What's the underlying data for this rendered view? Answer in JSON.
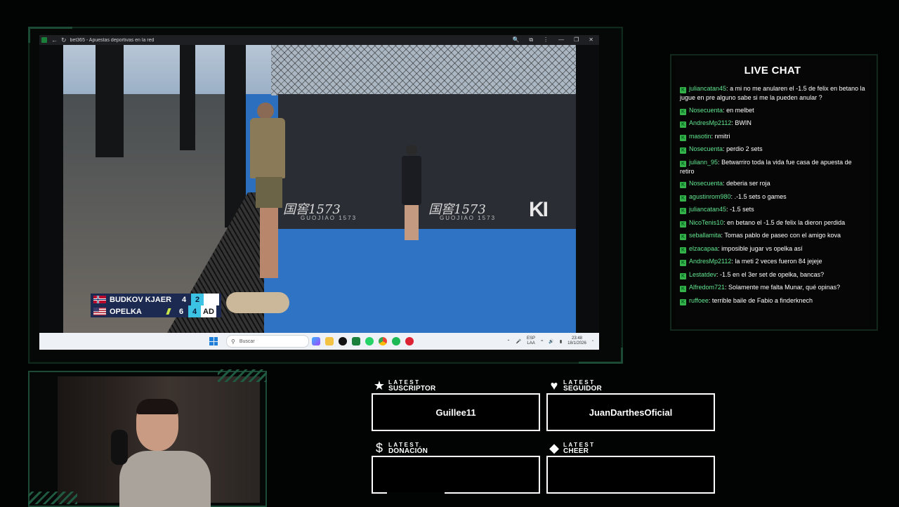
{
  "browser": {
    "title": "bet365 - Apuestas deportivas en la red"
  },
  "video": {
    "sponsor_left": "国窖1573",
    "sponsor_left_sub": "GUOJIAO 1573",
    "sponsor_right": "国窖1573",
    "sponsor_right_sub": "GUOJIAO 1573",
    "sponsor_ki": "KI"
  },
  "scoreboard": {
    "players": [
      {
        "name": "BUDKOV KJAER",
        "games": "4",
        "sets": "2",
        "points": ""
      },
      {
        "name": "OPELKA",
        "games": "6",
        "sets": "4",
        "points": "AD"
      }
    ]
  },
  "taskbar": {
    "search_placeholder": "Buscar",
    "lang_1": "ESP",
    "lang_2": "LAA",
    "time": "23:48",
    "date": "18/1/2026"
  },
  "chat": {
    "title": "LIVE CHAT",
    "messages": [
      {
        "user": "juliancatan45",
        "text": "a mi no me anularen el -1.5 de felix en betano la jugue en pre alguno sabe si me la pueden anular ?"
      },
      {
        "user": "Nosecuenta",
        "text": "en melbet"
      },
      {
        "user": "AndresMp2112",
        "text": "BWIN"
      },
      {
        "user": "masotin",
        "text": "nmitri"
      },
      {
        "user": "Nosecuenta",
        "text": "perdio 2 sets"
      },
      {
        "user": "juliann_95",
        "text": "Betwarriro toda la vida fue casa de apuesta de retiro"
      },
      {
        "user": "Nosecuenta",
        "text": "deberia ser roja"
      },
      {
        "user": "agustinrom980",
        "text": ".-1.5 sets o games"
      },
      {
        "user": "juliancatan45",
        "text": "-1.5 sets"
      },
      {
        "user": "NicoTenis10",
        "text": "en betano el -1.5 de felix la dieron perdida"
      },
      {
        "user": "seballamita",
        "text": "Tomas pablo de paseo con el amigo kova"
      },
      {
        "user": "elzacapaa",
        "text": "imposible jugar vs opelka así"
      },
      {
        "user": "AndresMp2112",
        "text": "la meti 2 veces fueron 84 jejeje"
      },
      {
        "user": "Lestatdev",
        "text": "-1.5 en el 3er set de opelka, bancas?"
      },
      {
        "user": "Alfredom721",
        "text": "Solamente me falta Munar, qué opinas?"
      },
      {
        "user": "ruffoee",
        "text": "terrible baile de Fabio a finderknech"
      }
    ]
  },
  "widgets": {
    "suscriptor": {
      "line1": "LATEST",
      "line2": "SUSCRIPTOR",
      "value": "Guillee11"
    },
    "seguidor": {
      "line1": "LATEST",
      "line2": "SEGUIDOR",
      "value": "JuanDarthesOficial"
    },
    "donacion": {
      "line1": "LATEST",
      "line2": "DONACIÓN",
      "value": ""
    },
    "cheer": {
      "line1": "LATEST",
      "line2": "CHEER",
      "value": ""
    }
  },
  "colors": {
    "accent_green": "#1c4a36",
    "chat_user": "#62e58f",
    "badge_green": "#35b24a",
    "score_set_highlight": "#3cc3e3"
  }
}
